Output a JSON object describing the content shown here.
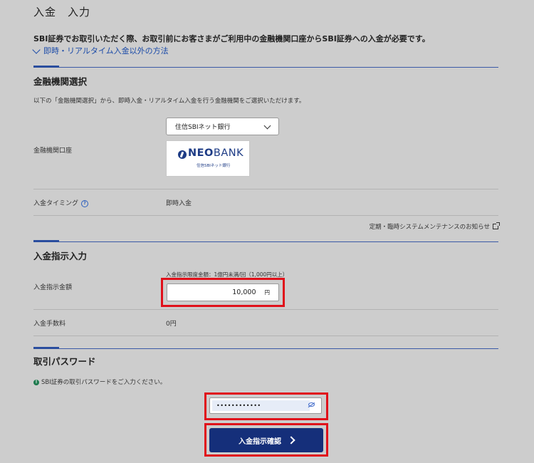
{
  "page": {
    "title": "入金　入力",
    "notice": "SBI証券でお取引いただく際、お取引前にお客さまがご利用中の金融機関口座からSBI証券への入金が必要です。",
    "other_methods_link": "即時・リアルタイム入金以外の方法"
  },
  "bank_section": {
    "title": "金融機関選択",
    "description": "以下の「金融機関選択」から、即時入金・リアルタイム入金を行う金融機関をご選択いただけます。",
    "account_label": "金融機関口座",
    "selected_bank": "住信SBIネット銀行",
    "logo": {
      "neo": "NEO",
      "bank": "BANK",
      "sub": "住信SBIネット銀行"
    },
    "timing_label": "入金タイミング",
    "timing_value": "即時入金",
    "maintenance_link": "定期・臨時システムメンテナンスのお知らせ"
  },
  "instruction_section": {
    "title": "入金指示入力",
    "limit_note": "入金指示限度金額：1億円未満/回（1,000円以上）",
    "amount_label": "入金指示金額",
    "amount_value": "10,000",
    "currency": "円",
    "fee_label": "入金手数料",
    "fee_value": "0円"
  },
  "password_section": {
    "title": "取引パスワード",
    "prompt": "SBI証券の取引パスワードをご入力ください。",
    "masked_value": "••••••••••••"
  },
  "actions": {
    "confirm_label": "入金指示確認"
  },
  "colors": {
    "accent": "#152f7a",
    "highlight": "#e0101a",
    "link": "#1a4aa8"
  }
}
